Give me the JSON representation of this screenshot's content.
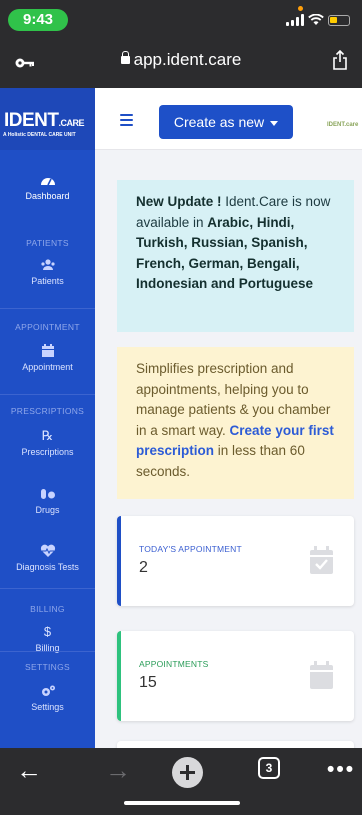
{
  "status_bar": {
    "time": "9:43"
  },
  "browser": {
    "url": "app.ident.care"
  },
  "sidebar": {
    "brand_title": "IDENT",
    "brand_suffix": ".CARE",
    "brand_subtitle": "A Holistic DENTAL CARE UNIT",
    "items": [
      {
        "label": "Dashboard",
        "icon": "dashboard-icon"
      },
      {
        "section": "PATIENTS"
      },
      {
        "label": "Patients",
        "icon": "patients-icon"
      },
      {
        "section": "APPOINTMENT"
      },
      {
        "label": "Appointment",
        "icon": "calendar-icon"
      },
      {
        "section": "PRESCRIPTIONS"
      },
      {
        "label": "Prescriptions",
        "icon": "rx-icon"
      },
      {
        "label": "Drugs",
        "icon": "pills-icon"
      },
      {
        "label": "Diagnosis Tests",
        "icon": "heartbeat-icon"
      },
      {
        "section": "BILLING"
      },
      {
        "label": "Billing",
        "icon": "dollar-icon"
      },
      {
        "section": "SETTINGS"
      },
      {
        "label": "Settings",
        "icon": "gears-icon"
      }
    ]
  },
  "topbar": {
    "create_label": "Create as new",
    "mini_logo": "IDENT.care"
  },
  "info_alert": {
    "lead": "New Update !",
    "text1": " Ident.Care is now available in ",
    "bold1": "Arabic, Hindi, Turkish, Russian, Spanish, French, German, Bengali, Indonesian and Portuguese"
  },
  "warn_alert": {
    "text1": "Simplifies prescription and appointments, helping you to manage patients & you chamber in a smart way.",
    "link": "Create your first prescription",
    "text2": " in less than 60 seconds."
  },
  "cards": [
    {
      "label": "TODAY'S APPOINTMENT",
      "value": "2",
      "accent": "#1f4fc6"
    },
    {
      "label": "APPOINTMENTS",
      "value": "15",
      "accent": "#2ec27e"
    }
  ],
  "toolbar": {
    "tabs_count": "3"
  }
}
